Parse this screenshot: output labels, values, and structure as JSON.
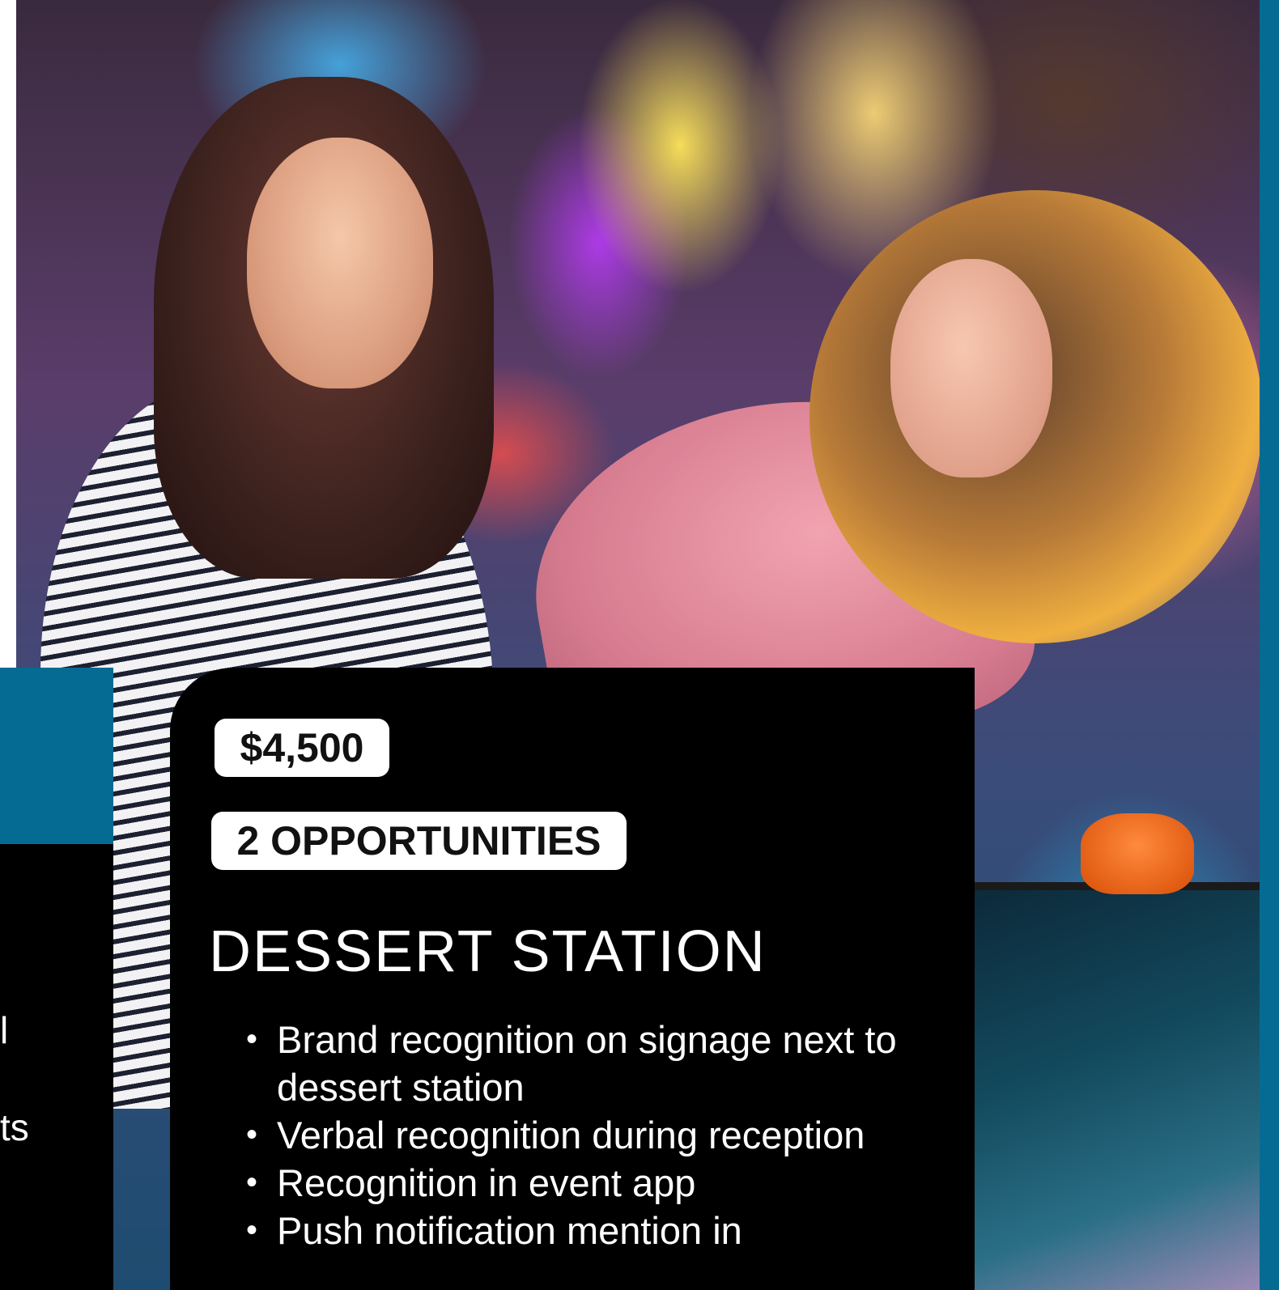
{
  "card": {
    "price": "$4,500",
    "opportunities": "2 OPPORTUNITIES",
    "title": "DESSERT STATION",
    "benefits": [
      "Brand recognition on signage next to dessert station",
      "Verbal recognition during reception",
      "Recognition in event app",
      "Push notification mention in"
    ]
  },
  "left_card_fragments": [
    "l",
    "ts"
  ],
  "colors": {
    "teal": "#066b93",
    "card_background": "#000000",
    "pill_background": "#ffffff"
  },
  "photo": {
    "subject": "photo-arcade-two-women-air-hockey"
  }
}
